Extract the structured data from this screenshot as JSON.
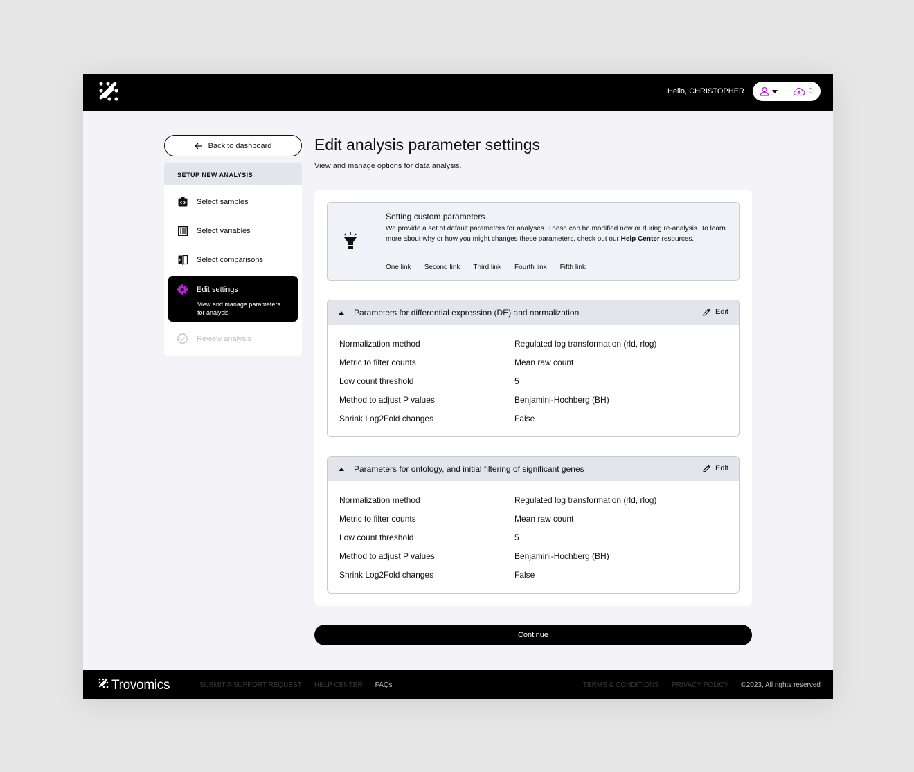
{
  "header": {
    "greeting": "Hello, CHRISTOPHER",
    "upload_count": "0",
    "accent": "#b026c9"
  },
  "sidebar": {
    "back_label": "Back to dashboard",
    "section_title": "SETUP NEW ANALYSIS",
    "steps": [
      {
        "label": "Select samples",
        "icon": "samples-icon"
      },
      {
        "label": "Select variables",
        "icon": "list-icon"
      },
      {
        "label": "Select comparisons",
        "icon": "compare-icon"
      },
      {
        "label": "Edit settings",
        "icon": "gear-icon",
        "sub": "View and manage parameters for analysis",
        "active": true
      },
      {
        "label": "Review analysis",
        "icon": "check-circle-icon",
        "disabled": true
      }
    ]
  },
  "main": {
    "title": "Edit analysis parameter settings",
    "subtitle": "View and manage options for data analysis.",
    "info": {
      "title": "Setting custom parameters",
      "body_before": "We provide a set of default parameters for analyses. These can be modified now or during re-analysis. To learn more about why or how you might changes these parameters, check out our ",
      "body_link": "Help Center",
      "body_after": " resources.",
      "links": [
        "One link",
        "Second link",
        "Third link",
        "Fourth link",
        "Fifth link"
      ]
    },
    "panels": [
      {
        "title": "Parameters for differential expression (DE) and normalization",
        "edit_label": "Edit",
        "rows": [
          {
            "label": "Normalization method",
            "value": "Regulated log transformation (rld, rlog)"
          },
          {
            "label": "Metric to filter counts",
            "value": "Mean raw count"
          },
          {
            "label": "Low count threshold",
            "value": "5"
          },
          {
            "label": "Method to adjust P values",
            "value": "Benjamini-Hochberg (BH)"
          },
          {
            "label": "Shrink Log2Fold changes",
            "value": "False"
          }
        ]
      },
      {
        "title": "Parameters for ontology, and initial filtering of significant genes",
        "edit_label": "Edit",
        "rows": [
          {
            "label": "Normalization method",
            "value": "Regulated log transformation (rld, rlog)"
          },
          {
            "label": "Metric to filter counts",
            "value": "Mean raw count"
          },
          {
            "label": "Low count threshold",
            "value": "5"
          },
          {
            "label": "Method to adjust P values",
            "value": "Benjamini-Hochberg (BH)"
          },
          {
            "label": "Shrink Log2Fold changes",
            "value": "False"
          }
        ]
      }
    ],
    "continue_label": "Continue"
  },
  "footer": {
    "brand": "Trovomics",
    "links_left": [
      "SUBMIT A SUPPORT REQUEST",
      "HELP CENTER",
      "FAQs"
    ],
    "links_right": [
      "TERMS & CONDITIONS",
      "PRIVACY POLICY"
    ],
    "copyright": "©2023, All rights reserved"
  }
}
